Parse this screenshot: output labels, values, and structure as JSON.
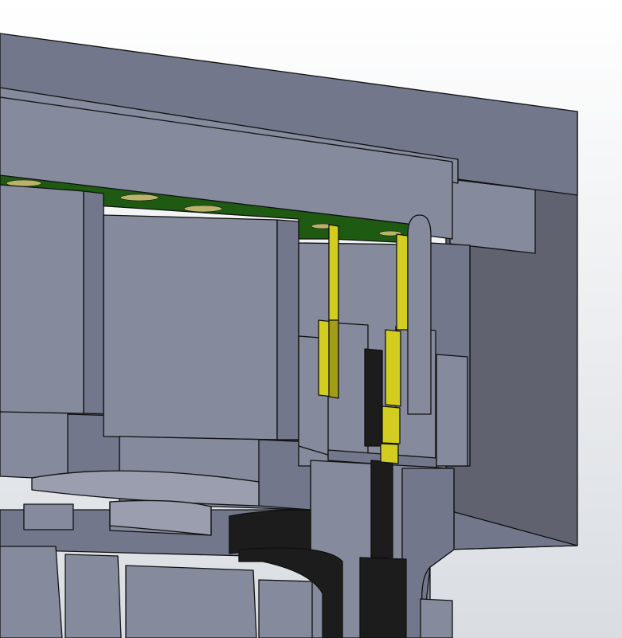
{
  "viewport": {
    "background_top": "#ffffff",
    "background_bottom": "#d9dde2"
  },
  "colors": {
    "housing_light": "#868a9d",
    "housing_mid": "#73778b",
    "housing_dark": "#60636f",
    "housing_face": "#9a9eae",
    "pcb_green": "#1f5a12",
    "pad_gold": "#b9b46a",
    "pin_yellow": "#d2cd1e",
    "pin_yellow_dark": "#a29c16",
    "insulator_black": "#1c1c1c",
    "edge": "#101010"
  }
}
